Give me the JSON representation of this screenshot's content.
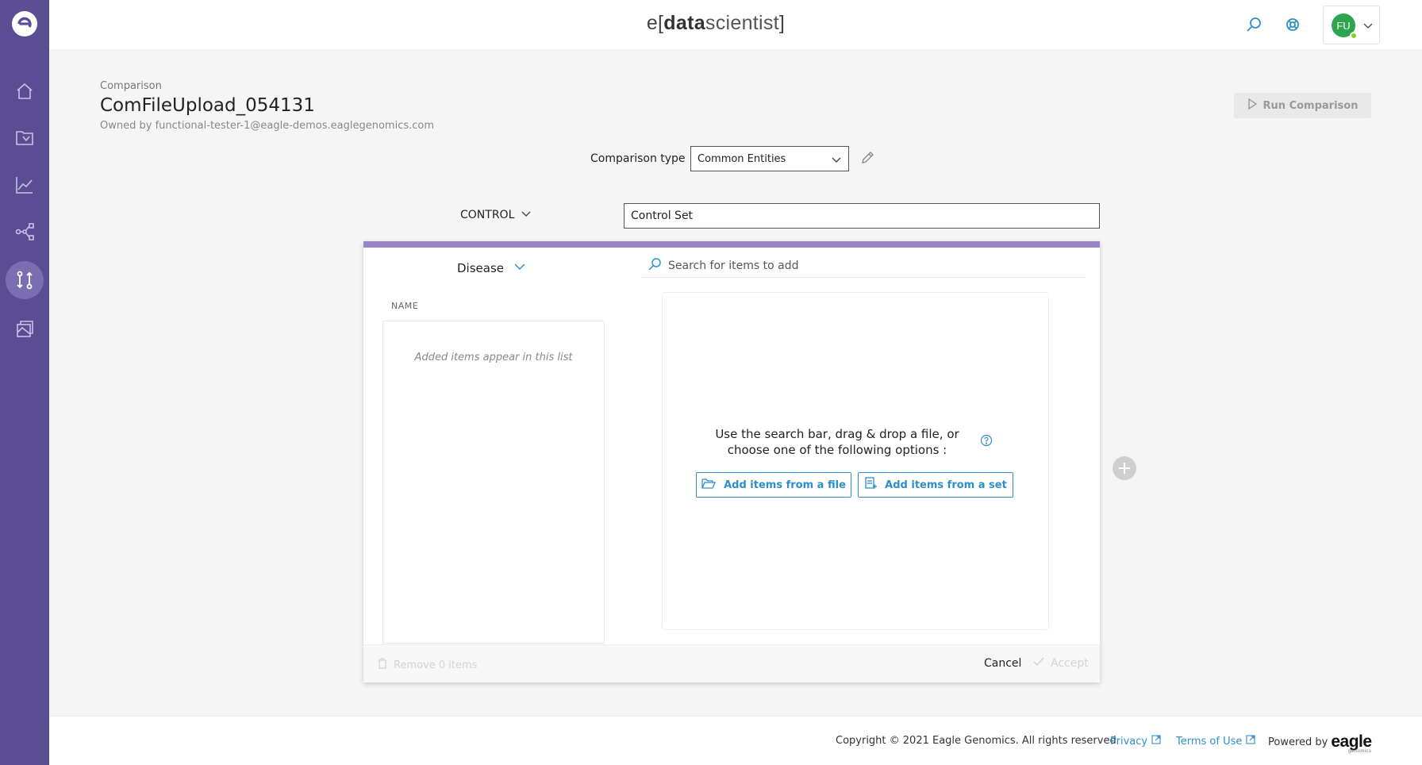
{
  "header": {
    "brand_e": "e",
    "brand_open": "[",
    "brand_data": "data",
    "brand_scientist": "scientist",
    "brand_close": "]",
    "user_initials": "FU"
  },
  "page": {
    "breadcrumb": "Comparison",
    "title": "ComFileUpload_054131",
    "owner": "Owned by functional-tester-1@eagle-demos.eaglegenomics.com",
    "run_label": "Run Comparison"
  },
  "comparison_type": {
    "label": "Comparison type",
    "selected": "Common Entities"
  },
  "control": {
    "label": "CONTROL",
    "set_name": "Control Set"
  },
  "panel": {
    "entity": "Disease",
    "search_placeholder": "Search for items to add",
    "column_name": "NAME",
    "empty_list": "Added items appear in this list",
    "drop_msg_line1": "Use the search bar, drag & drop a file, or",
    "drop_msg_line2": "choose one of the following options :",
    "add_from_file": "Add items from a file",
    "add_from_set": "Add items from a set",
    "remove_items": "Remove 0 items",
    "cancel": "Cancel",
    "accept": "Accept"
  },
  "footer": {
    "copyright": "Copyright © 2021 Eagle Genomics. All rights reserved",
    "privacy": "Privacy",
    "terms": "Terms of Use",
    "powered_by": "Powered by",
    "logo_text": "eagle",
    "logo_sub": "genomics"
  },
  "colors": {
    "rail": "#5b4d93",
    "accent": "#2d8fc5",
    "panel_top": "#9b84c4",
    "avatar": "#2ea44f"
  }
}
